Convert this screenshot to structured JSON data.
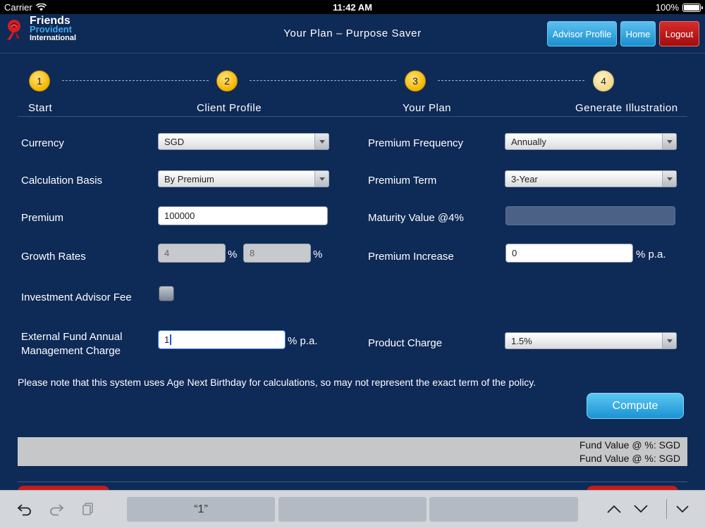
{
  "status_bar": {
    "carrier": "Carrier",
    "time": "11:42 AM",
    "battery": "100%"
  },
  "header": {
    "logo": {
      "line1": "Friends",
      "line2": "Provident",
      "line3": "International"
    },
    "title": "Your Plan – Purpose Saver",
    "buttons": {
      "advisor_profile": "Advisor Profile",
      "home": "Home",
      "logout": "Logout"
    }
  },
  "steps": [
    {
      "number": "1",
      "label": "Start"
    },
    {
      "number": "2",
      "label": "Client Profile"
    },
    {
      "number": "3",
      "label": "Your Plan"
    },
    {
      "number": "4",
      "label": "Generate Illustration"
    }
  ],
  "form": {
    "currency": {
      "label": "Currency",
      "value": "SGD"
    },
    "calculation_basis": {
      "label": "Calculation Basis",
      "value": "By Premium"
    },
    "premium": {
      "label": "Premium",
      "value": "100000"
    },
    "growth_rates": {
      "label": "Growth Rates",
      "rate1": "4",
      "rate2": "8",
      "unit": "%"
    },
    "investment_advisor_fee": {
      "label": "Investment Advisor Fee",
      "checked": false
    },
    "external_fund_charge": {
      "label_line1": "External Fund Annual",
      "label_line2": "Management Charge",
      "value": "1",
      "unit": "% p.a."
    },
    "premium_frequency": {
      "label": "Premium Frequency",
      "value": "Annually"
    },
    "premium_term": {
      "label": "Premium Term",
      "value": "3-Year"
    },
    "maturity_value": {
      "label": "Maturity Value @4%",
      "value": ""
    },
    "premium_increase": {
      "label": "Premium Increase",
      "value": "0",
      "unit": "% p.a."
    },
    "product_charge": {
      "label": "Product Charge",
      "value": "1.5%"
    }
  },
  "note": "Please note that this system uses Age Next Birthday for calculations, so may not represent the exact term of the policy.",
  "compute_label": "Compute",
  "results": [
    "Fund Value @ %: SGD",
    "Fund Value @ %: SGD"
  ],
  "keyboard_bar": {
    "suggestions": [
      "“1”",
      "",
      ""
    ]
  },
  "colors": {
    "background": "#0e2a57",
    "accent_blue": "#1a8fcf",
    "logout_red": "#a30d0d",
    "step_yellow": "#f4b500"
  }
}
